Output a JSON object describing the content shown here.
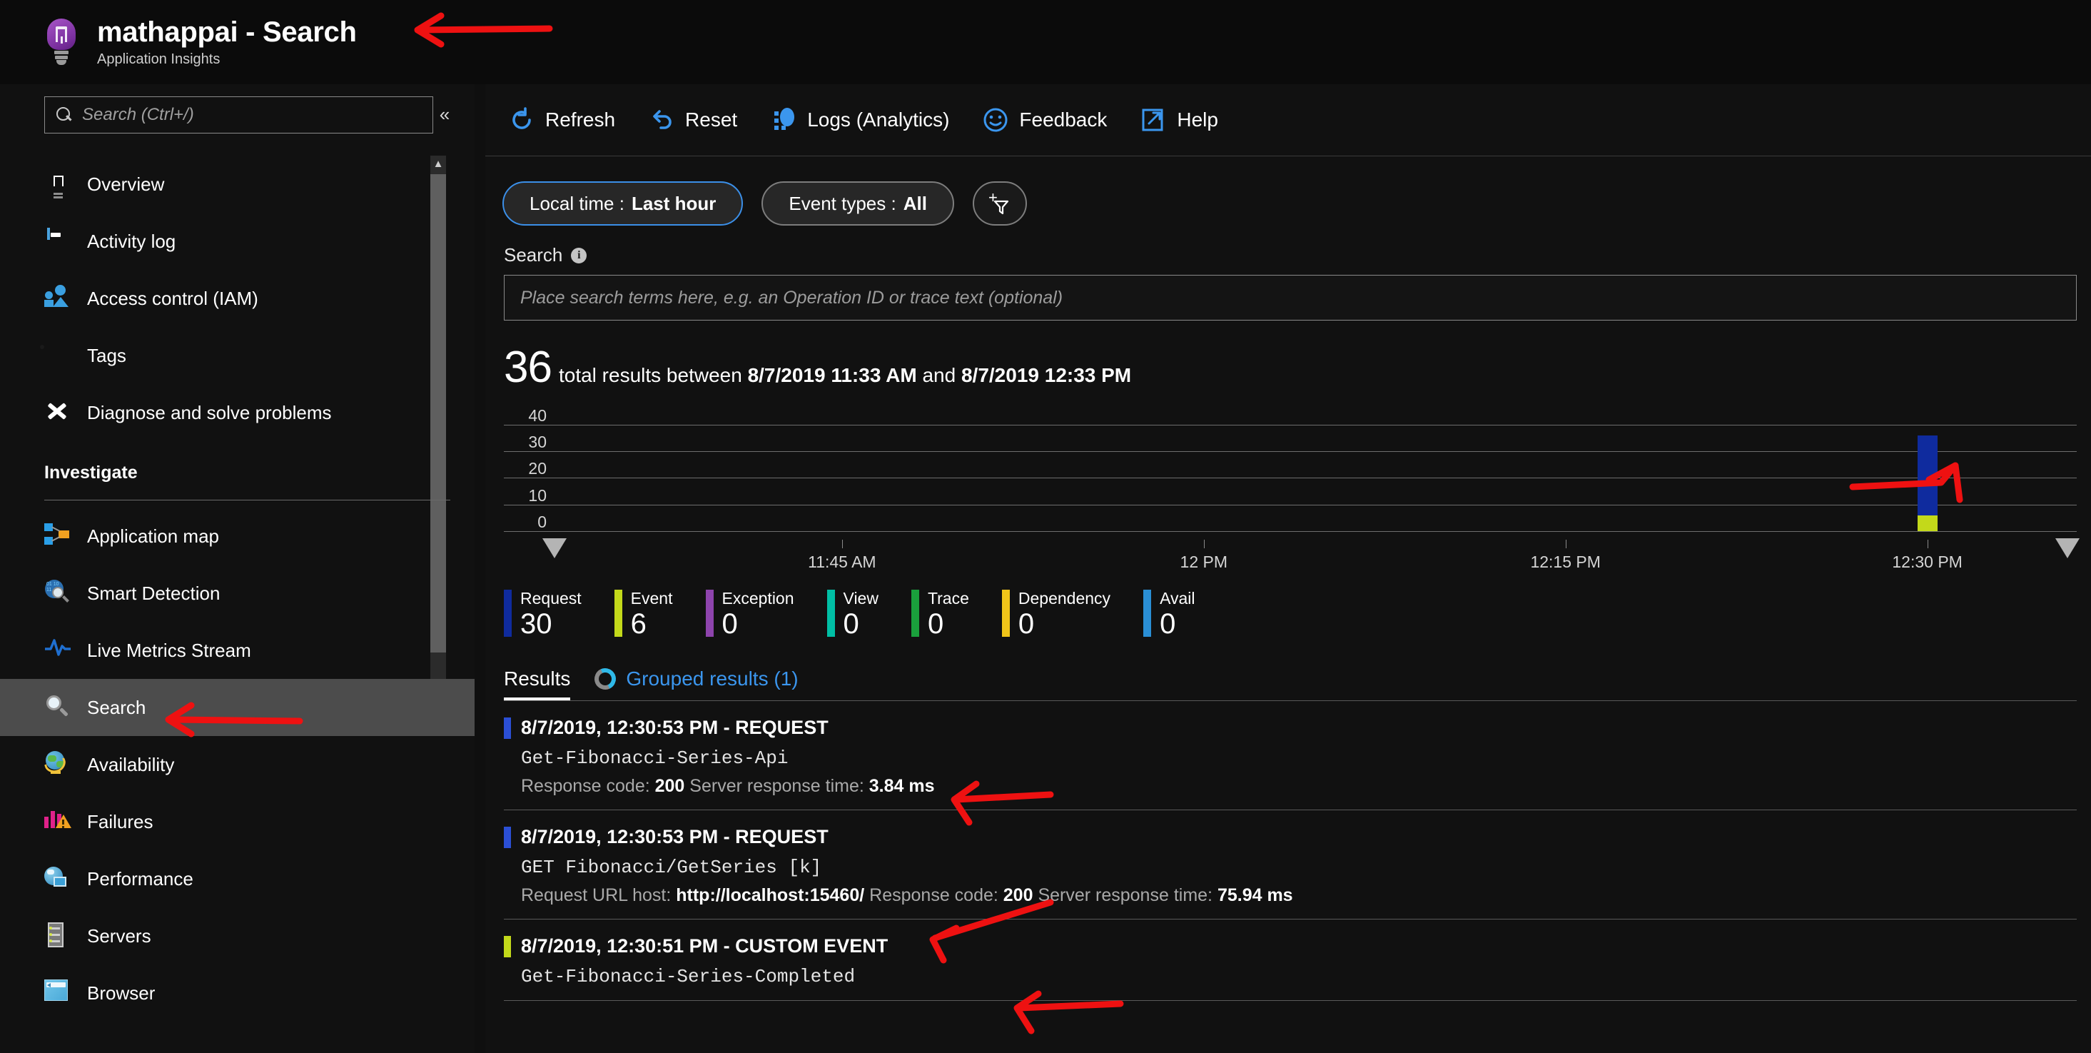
{
  "header": {
    "title": "mathappai - Search",
    "subtitle": "Application Insights",
    "icon": "app-insights-bulb-icon"
  },
  "sidebar": {
    "search": {
      "placeholder": "Search (Ctrl+/)",
      "value": "",
      "icon": "search-icon"
    },
    "collapse_icon": "«",
    "items": [
      {
        "label": "Overview",
        "icon": "bulb-icon",
        "selected": false
      },
      {
        "label": "Activity log",
        "icon": "book-icon",
        "selected": false
      },
      {
        "label": "Access control (IAM)",
        "icon": "people-icon",
        "selected": false
      },
      {
        "label": "Tags",
        "icon": "tag-icon",
        "selected": false
      },
      {
        "label": "Diagnose and solve problems",
        "icon": "wrench-icon",
        "selected": false
      }
    ],
    "section_label": "Investigate",
    "investigate_items": [
      {
        "label": "Application map",
        "icon": "application-map-icon",
        "selected": false
      },
      {
        "label": "Smart Detection",
        "icon": "smart-detection-icon",
        "selected": false
      },
      {
        "label": "Live Metrics Stream",
        "icon": "live-metrics-icon",
        "selected": false
      },
      {
        "label": "Search",
        "icon": "search-icon",
        "selected": true
      },
      {
        "label": "Availability",
        "icon": "globe-icon",
        "selected": false
      },
      {
        "label": "Failures",
        "icon": "failures-icon",
        "selected": false
      },
      {
        "label": "Performance",
        "icon": "performance-icon",
        "selected": false
      },
      {
        "label": "Servers",
        "icon": "server-icon",
        "selected": false
      },
      {
        "label": "Browser",
        "icon": "browser-icon",
        "selected": false
      }
    ]
  },
  "toolbar": [
    {
      "label": "Refresh",
      "icon": "refresh-icon"
    },
    {
      "label": "Reset",
      "icon": "undo-icon"
    },
    {
      "label": "Logs (Analytics)",
      "icon": "logs-icon"
    },
    {
      "label": "Feedback",
      "icon": "smiley-icon"
    },
    {
      "label": "Help",
      "icon": "external-link-icon"
    }
  ],
  "filters": {
    "time": {
      "prefix": "Local time :",
      "value": "Last hour",
      "active": true
    },
    "event_types": {
      "prefix": "Event types :",
      "value": "All",
      "active": false
    },
    "add_filter_icon": "add-filter-icon"
  },
  "search": {
    "label": "Search",
    "info_icon": "info-icon",
    "placeholder": "Place search terms here, e.g. an Operation ID or trace text (optional)",
    "value": ""
  },
  "summary": {
    "count": "36",
    "text_before": "total results between",
    "start": "8/7/2019 11:33 AM",
    "text_middle": "and",
    "end": "8/7/2019 12:33 PM"
  },
  "chart_data": {
    "type": "bar",
    "title": "",
    "xlabel": "",
    "ylabel": "",
    "ylim": [
      0,
      45
    ],
    "yticks": [
      0,
      10,
      20,
      30,
      40
    ],
    "xticks": [
      "11:45 AM",
      "12 PM",
      "12:15 PM",
      "12:30 PM"
    ],
    "xtick_positions_pct": [
      21.5,
      44.5,
      67.5,
      90.5
    ],
    "grid": true,
    "legend": "below",
    "stacked": true,
    "bars": [
      {
        "x": "12:30 PM",
        "x_pct": 90.5,
        "total": 36,
        "segments": [
          {
            "name": "Event",
            "value": 6,
            "color": "#c3d91a"
          },
          {
            "name": "Request",
            "value": 30,
            "color": "#0f2b9e"
          }
        ]
      }
    ],
    "range_handles": [
      {
        "name": "range-start-handle",
        "x_pct": 3.2
      },
      {
        "name": "range-end-handle",
        "x_pct": 99.4
      }
    ]
  },
  "legend": [
    {
      "name": "Request",
      "value": "30",
      "color": "#0f2b9e"
    },
    {
      "name": "Event",
      "value": "6",
      "color": "#c3d91a"
    },
    {
      "name": "Exception",
      "value": "0",
      "color": "#8e44ad"
    },
    {
      "name": "View",
      "value": "0",
      "color": "#00bfa5"
    },
    {
      "name": "Trace",
      "value": "0",
      "color": "#1aa03c"
    },
    {
      "name": "Dependency",
      "value": "0",
      "color": "#f0c419"
    },
    {
      "name": "Avail",
      "value": "0",
      "color": "#2a8fd6"
    }
  ],
  "tabs": {
    "results_label": "Results",
    "grouped_label": "Grouped results (1)",
    "grouped_icon": "donut-loading-icon"
  },
  "results": [
    {
      "chip_color": "#2b4fd6",
      "title": "8/7/2019, 12:30:53 PM - REQUEST",
      "name": "Get-Fibonacci-Series-Api",
      "meta": [
        {
          "label": "Response code:",
          "value": "200"
        },
        {
          "label": "Server response time:",
          "value": "3.84 ms"
        }
      ]
    },
    {
      "chip_color": "#2b4fd6",
      "title": "8/7/2019, 12:30:53 PM - REQUEST",
      "name": "GET Fibonacci/GetSeries [k]",
      "meta": [
        {
          "label": "Request URL host:",
          "value": "http://localhost:15460/"
        },
        {
          "label": "Response code:",
          "value": "200"
        },
        {
          "label": "Server response time:",
          "value": "75.94 ms"
        }
      ]
    },
    {
      "chip_color": "#c3d91a",
      "title": "8/7/2019, 12:30:51 PM - CUSTOM EVENT",
      "name": "Get-Fibonacci-Series-Completed",
      "meta": []
    }
  ],
  "annotations": {
    "color": "#ee1111",
    "marks": [
      "arrow-to-page-title",
      "arrow-to-chart-bar",
      "arrow-to-sidebar-search",
      "arrow-to-result-1",
      "arrow-to-result-2",
      "arrow-to-result-3"
    ]
  }
}
